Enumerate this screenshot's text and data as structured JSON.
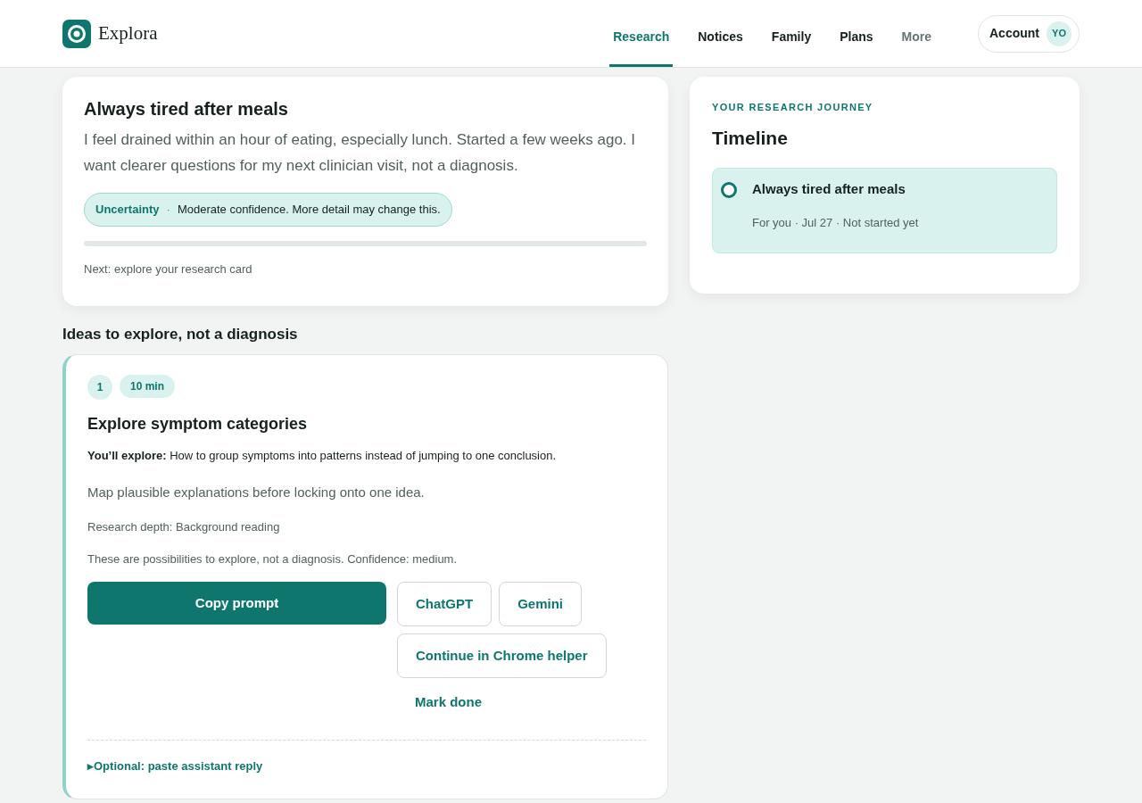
{
  "brand": {
    "name": "Explora"
  },
  "nav": [
    {
      "label": "Research",
      "selected": true,
      "muted": false
    },
    {
      "label": "Notices",
      "selected": false,
      "muted": false
    },
    {
      "label": "Family",
      "selected": false,
      "muted": false
    },
    {
      "label": "Plans",
      "selected": false,
      "muted": false
    },
    {
      "label": "More",
      "selected": false,
      "muted": true
    }
  ],
  "account": {
    "label": "Account",
    "initials": "YO"
  },
  "question": {
    "title": "Always tired after meals",
    "description": "I feel drained within an hour of eating, especially lunch. Started a few weeks ago. I want clearer questions for my next clinician visit, not a diagnosis.",
    "uncertainty_label": "Uncertainty",
    "separator": "·",
    "uncertainty_text": "Moderate confidence. More detail may change this.",
    "progress": {
      "level": 0
    },
    "next": "Next: explore your research card"
  },
  "ideas_heading": "Ideas to explore, not a diagnosis",
  "ideas": [
    {
      "number": "1",
      "duration": "10 min",
      "title": "Explore symptom categories",
      "explore": "**You’ll explore:** How to group symptoms into patterns instead of jumping to one conclusion.",
      "summary": "Map plausible explanations before locking onto one idea.",
      "depth": "Research depth: Background reading",
      "note": "These are possibilities to explore, not a diagnosis. Confidence: medium.",
      "primary_action": "Copy prompt",
      "assistants": [
        "ChatGPT",
        "Gemini"
      ],
      "helper_action": "Continue in Chrome helper",
      "done_action": "Mark done",
      "optional": {
        "toggle": "▸",
        "label": "Optional: paste assistant reply",
        "expanded": false
      }
    }
  ],
  "timeline": {
    "eyebrow": "YOUR RESEARCH JOURNEY",
    "title": "Timeline",
    "items": [
      {
        "title": "Always tired after meals",
        "meta": "For you · Jul 27 · Not started yet",
        "done": false
      }
    ]
  }
}
